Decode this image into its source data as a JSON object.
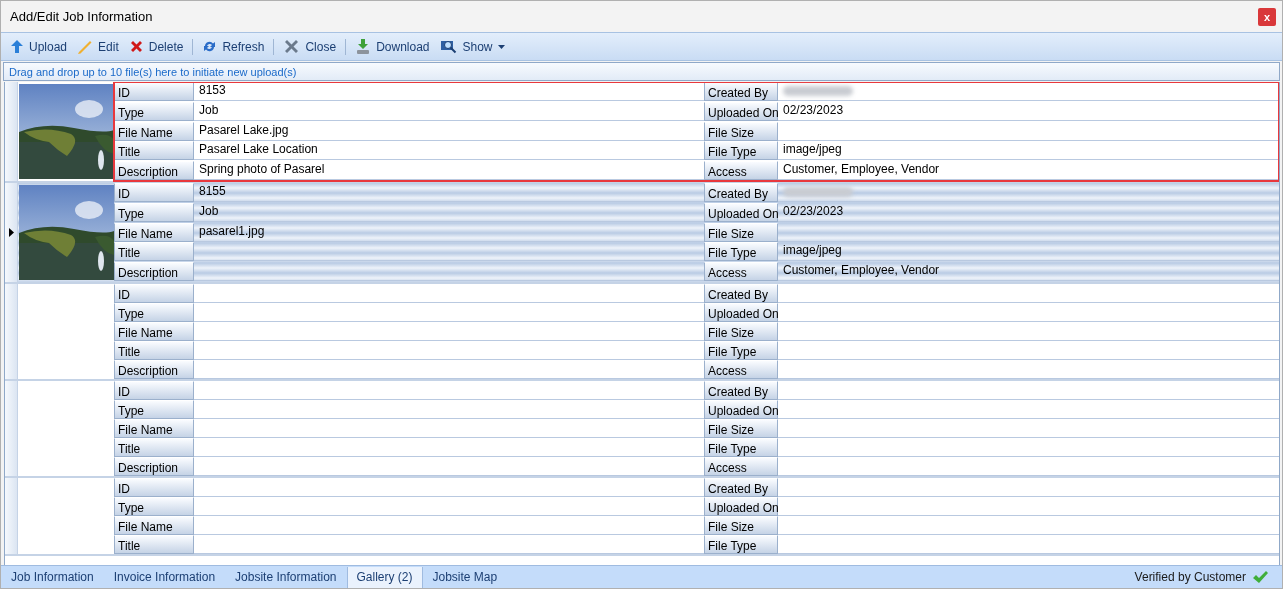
{
  "window": {
    "title": "Add/Edit Job Information",
    "close": "x"
  },
  "toolbar": [
    [
      {
        "label": "Upload"
      },
      {
        "label": "Edit"
      },
      {
        "label": "Delete"
      }
    ],
    [
      {
        "label": "Refresh"
      }
    ],
    [
      {
        "label": "Close"
      }
    ],
    [
      {
        "label": "Download"
      },
      {
        "label": "Show",
        "dropdown": true
      }
    ]
  ],
  "drop_hint": "Drag and drop up to 10 file(s) here to initiate new upload(s)",
  "records": [
    {
      "selected": false,
      "highlighted": true,
      "fields_left": [
        {
          "label": "ID",
          "value": "8153"
        },
        {
          "label": "Type",
          "value": "Job"
        },
        {
          "label": "File Name",
          "value": "Pasarel Lake.jpg"
        },
        {
          "label": "Title",
          "value": "Pasarel Lake Location"
        },
        {
          "label": "Description",
          "value": "Spring photo of Pasarel"
        }
      ],
      "fields_right": [
        {
          "label": "Created By",
          "redacted": true
        },
        {
          "label": "Uploaded On",
          "value": "02/23/2023"
        },
        {
          "label": "File Size"
        },
        {
          "label": "File Type",
          "value": "image/jpeg"
        },
        {
          "label": "Access",
          "value": "Customer, Employee, Vendor"
        }
      ]
    },
    {
      "selected": true,
      "highlighted": false,
      "fields_left": [
        {
          "label": "ID",
          "value": "8155"
        },
        {
          "label": "Type",
          "value": "Job"
        },
        {
          "label": "File Name",
          "value": "pasarel1.jpg"
        },
        {
          "label": "Title"
        },
        {
          "label": "Description"
        }
      ],
      "fields_right": [
        {
          "label": "Created By",
          "redacted": true
        },
        {
          "label": "Uploaded On",
          "value": "02/23/2023"
        },
        {
          "label": "File Size"
        },
        {
          "label": "File Type",
          "value": "image/jpeg"
        },
        {
          "label": "Access",
          "value": "Customer, Employee, Vendor"
        }
      ]
    },
    {
      "selected": false,
      "highlighted": false,
      "fields_left": [
        {
          "label": "ID"
        },
        {
          "label": "Type"
        },
        {
          "label": "File Name"
        },
        {
          "label": "Title"
        },
        {
          "label": "Description"
        }
      ],
      "fields_right": [
        {
          "label": "Created By",
          "redacted": false
        },
        {
          "label": "Uploaded On"
        },
        {
          "label": "File Size"
        },
        {
          "label": "File Type"
        },
        {
          "label": "Access"
        }
      ]
    },
    {
      "selected": false,
      "highlighted": false,
      "fields_left": [
        {
          "label": "ID"
        },
        {
          "label": "Type"
        },
        {
          "label": "File Name"
        },
        {
          "label": "Title"
        },
        {
          "label": "Description"
        }
      ],
      "fields_right": [
        {
          "label": "Created By",
          "redacted": false
        },
        {
          "label": "Uploaded On"
        },
        {
          "label": "File Size"
        },
        {
          "label": "File Type"
        },
        {
          "label": "Access"
        }
      ]
    },
    {
      "selected": false,
      "highlighted": false,
      "fields_left": [
        {
          "label": "ID"
        },
        {
          "label": "Type"
        },
        {
          "label": "File Name"
        },
        {
          "label": "Title"
        }
      ],
      "fields_right": [
        {
          "label": "Created By",
          "redacted": false
        },
        {
          "label": "Uploaded On"
        },
        {
          "label": "File Size"
        },
        {
          "label": "File Type"
        }
      ]
    }
  ],
  "tabs": [
    {
      "label": "Job Information",
      "selected": false
    },
    {
      "label": "Invoice Information",
      "selected": false
    },
    {
      "label": "Jobsite Information",
      "selected": false
    },
    {
      "label": "Gallery (2)",
      "selected": true
    },
    {
      "label": "Jobsite Map",
      "selected": false
    }
  ],
  "status": {
    "text": "Verified by Customer",
    "verified": true
  }
}
